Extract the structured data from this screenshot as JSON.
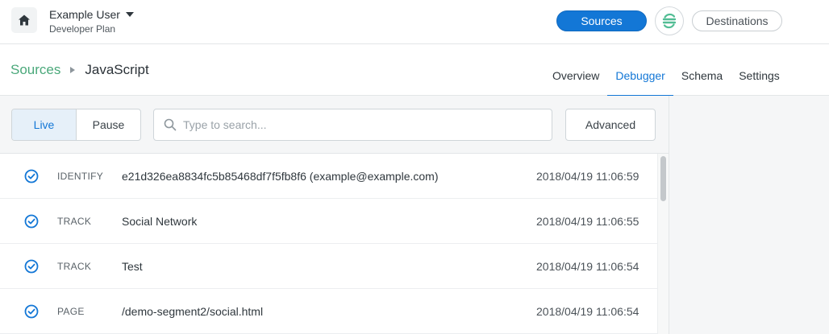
{
  "workspace": {
    "name": "Example User",
    "plan": "Developer Plan"
  },
  "nav": {
    "sources_label": "Sources",
    "destinations_label": "Destinations"
  },
  "breadcrumb": {
    "parent": "Sources",
    "current": "JavaScript"
  },
  "tabs": [
    {
      "label": "Overview",
      "active": false
    },
    {
      "label": "Debugger",
      "active": true
    },
    {
      "label": "Schema",
      "active": false
    },
    {
      "label": "Settings",
      "active": false
    }
  ],
  "toolbar": {
    "live_label": "Live",
    "pause_label": "Pause",
    "search_placeholder": "Type to search...",
    "advanced_label": "Advanced"
  },
  "events": [
    {
      "type": "IDENTIFY",
      "name": "e21d326ea8834fc5b85468df7f5fb8f6 (example@example.com)",
      "time": "2018/04/19 11:06:59"
    },
    {
      "type": "TRACK",
      "name": "Social Network",
      "time": "2018/04/19 11:06:55"
    },
    {
      "type": "TRACK",
      "name": "Test",
      "time": "2018/04/19 11:06:54"
    },
    {
      "type": "PAGE",
      "name": "/demo-segment2/social.html",
      "time": "2018/04/19 11:06:54"
    }
  ],
  "colors": {
    "accent": "#1377d6",
    "brand_green": "#4aa87a"
  }
}
